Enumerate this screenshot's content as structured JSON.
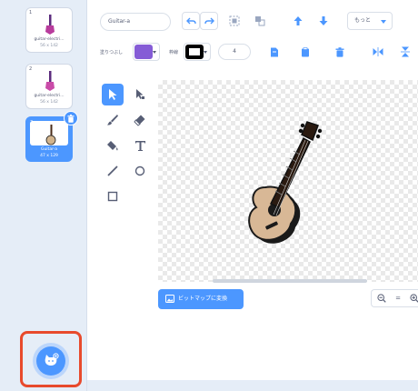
{
  "costumes": [
    {
      "number": "1",
      "name": "guitar-electri...",
      "size": "56 x 142",
      "selected": false
    },
    {
      "number": "2",
      "name": "guitar-electri...",
      "size": "56 x 142",
      "selected": false
    },
    {
      "number": "3",
      "name": "Guitar-a",
      "size": "47 x 129",
      "selected": true
    }
  ],
  "toolbar": {
    "costume_name": "Guitar-a",
    "more_label": "もっと"
  },
  "fill": {
    "label": "塗りつぶし",
    "color": "#855cd6"
  },
  "outline": {
    "label": "枠線",
    "color": "#000000",
    "width": "4"
  },
  "canvas": {
    "convert_bitmap_label": "ビットマップに変換"
  },
  "zoom": {
    "reset_label": "="
  },
  "colors": {
    "accent": "#4c97ff",
    "highlight": "#e84a2c",
    "panel": "#e5edf7"
  }
}
